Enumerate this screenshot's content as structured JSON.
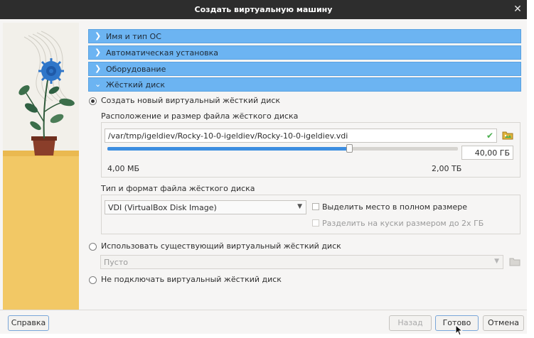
{
  "window": {
    "title": "Создать виртуальную машину",
    "close_glyph": "✕"
  },
  "sections": [
    {
      "label": "Имя и тип ОС",
      "state": "collapsed"
    },
    {
      "label": "Автоматическая установка",
      "state": "collapsed"
    },
    {
      "label": "Оборудование",
      "state": "collapsed"
    },
    {
      "label": "Жёсткий диск",
      "state": "expanded"
    }
  ],
  "disk": {
    "create_new": {
      "label": "Создать новый виртуальный жёсткий диск",
      "selected": true
    },
    "location_group_label": "Расположение и размер файла жёсткого диска",
    "path_value": "/var/tmp/igeldiev/Rocky-10-0-igeldiev/Rocky-10-0-igeldiev.vdi",
    "size_value": "40,00 ГБ",
    "size_fraction": 0.69,
    "slider_min": "4,00 МБ",
    "slider_max": "2,00 ТБ",
    "type_group_label": "Тип и формат файла жёсткого диска",
    "format_selected": "VDI (VirtualBox Disk Image)",
    "preallocate_label": "Выделить место в полном размере",
    "split_label": "Разделить на куски размером до 2х ГБ",
    "use_existing": {
      "label": "Использовать существующий виртуальный жёсткий диск",
      "selected": false
    },
    "existing_value": "Пусто",
    "no_disk": {
      "label": "Не подключать виртуальный жёсткий диск",
      "selected": false
    }
  },
  "footer": {
    "help_label": "Справка",
    "back_label": "Назад",
    "finish_label": "Готово",
    "cancel_label": "Отмена"
  },
  "colors": {
    "section_bar": "#6cb4f2",
    "accent": "#3d8ee0",
    "ok_check": "#4caf50"
  }
}
